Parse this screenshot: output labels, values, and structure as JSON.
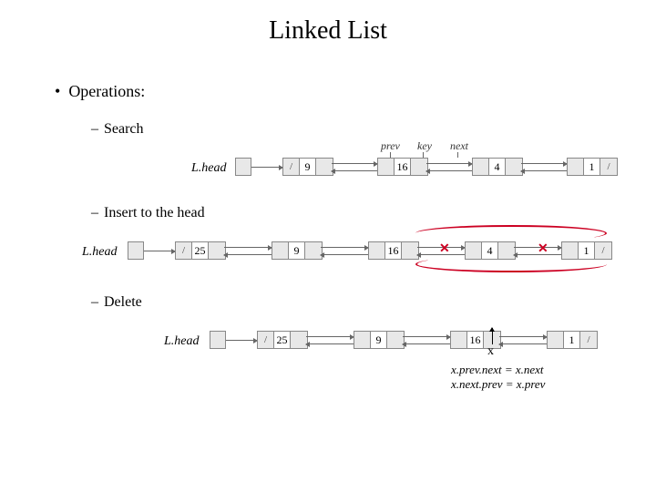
{
  "title": "Linked List",
  "bullet": "Operations:",
  "ops": {
    "search": "Search",
    "insert": "Insert to the head",
    "delete": "Delete"
  },
  "labels": {
    "lhead": "L.head",
    "prev": "prev",
    "key": "key",
    "next": "next",
    "x": "x"
  },
  "pseudo": {
    "line1": "x.prev.next  =  x.next",
    "line2": "x.next.prev  =  x.prev"
  },
  "lists": {
    "search": [
      "9",
      "16",
      "4",
      "1"
    ],
    "insert": [
      "25",
      "9",
      "16",
      "4",
      "1"
    ],
    "delete": [
      "25",
      "9",
      "16",
      "1"
    ]
  }
}
